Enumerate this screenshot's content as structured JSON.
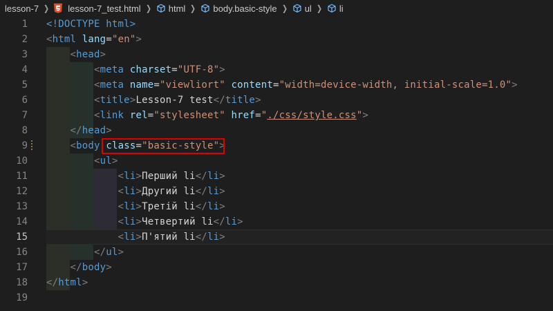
{
  "breadcrumb": {
    "folder": "lesson-7",
    "file": "lesson-7_test.html",
    "items": [
      "html",
      "body.basic-style",
      "ul",
      "li"
    ]
  },
  "editor": {
    "active_line": 15,
    "lines": [
      {
        "n": "1",
        "parts": [
          [
            "doctype",
            "<!DOCTYPE html>"
          ]
        ]
      },
      {
        "n": "2",
        "parts": [
          [
            "tag-br",
            "<"
          ],
          [
            "tag",
            "html"
          ],
          [
            "plain",
            " "
          ],
          [
            "attr",
            "lang"
          ],
          [
            "plain",
            "="
          ],
          [
            "str",
            "\"en\""
          ],
          [
            "tag-br",
            ">"
          ]
        ]
      },
      {
        "n": "3",
        "parts": [
          [
            "plain",
            "    "
          ],
          [
            "tag-br",
            "<"
          ],
          [
            "tag",
            "head"
          ],
          [
            "tag-br",
            ">"
          ]
        ]
      },
      {
        "n": "4",
        "parts": [
          [
            "plain",
            "        "
          ],
          [
            "tag-br",
            "<"
          ],
          [
            "tag",
            "meta"
          ],
          [
            "plain",
            " "
          ],
          [
            "attr",
            "charset"
          ],
          [
            "plain",
            "="
          ],
          [
            "str",
            "\"UTF-8\""
          ],
          [
            "tag-br",
            ">"
          ]
        ]
      },
      {
        "n": "5",
        "parts": [
          [
            "plain",
            "        "
          ],
          [
            "tag-br",
            "<"
          ],
          [
            "tag",
            "meta"
          ],
          [
            "plain",
            " "
          ],
          [
            "attr",
            "name"
          ],
          [
            "plain",
            "="
          ],
          [
            "str",
            "\"viewliort\""
          ],
          [
            "plain",
            " "
          ],
          [
            "attr",
            "content"
          ],
          [
            "plain",
            "="
          ],
          [
            "str",
            "\"width=device-width, initial-scale=1.0\""
          ],
          [
            "tag-br",
            ">"
          ]
        ]
      },
      {
        "n": "6",
        "parts": [
          [
            "plain",
            "        "
          ],
          [
            "tag-br",
            "<"
          ],
          [
            "tag",
            "title"
          ],
          [
            "tag-br",
            ">"
          ],
          [
            "plain",
            "Lesson-7 test"
          ],
          [
            "tag-br",
            "</"
          ],
          [
            "tag",
            "title"
          ],
          [
            "tag-br",
            ">"
          ]
        ]
      },
      {
        "n": "7",
        "parts": [
          [
            "plain",
            "        "
          ],
          [
            "tag-br",
            "<"
          ],
          [
            "tag",
            "link"
          ],
          [
            "plain",
            " "
          ],
          [
            "attr",
            "rel"
          ],
          [
            "plain",
            "="
          ],
          [
            "str",
            "\"stylesheet\""
          ],
          [
            "plain",
            " "
          ],
          [
            "attr",
            "href"
          ],
          [
            "plain",
            "="
          ],
          [
            "str",
            "\""
          ],
          [
            "link-str",
            "./css/style.css"
          ],
          [
            "str",
            "\""
          ],
          [
            "tag-br",
            ">"
          ]
        ]
      },
      {
        "n": "8",
        "parts": [
          [
            "plain",
            "    "
          ],
          [
            "tag-br",
            "</"
          ],
          [
            "tag",
            "head"
          ],
          [
            "tag-br",
            ">"
          ]
        ]
      },
      {
        "n": "9",
        "parts": [
          [
            "plain",
            "    "
          ],
          [
            "tag-br",
            "<"
          ],
          [
            "tag",
            "body"
          ],
          [
            "plain",
            " "
          ],
          [
            "attr",
            "class"
          ],
          [
            "plain",
            "="
          ],
          [
            "str",
            "\"basic-style\""
          ],
          [
            "tag-br",
            ">"
          ]
        ]
      },
      {
        "n": "10",
        "parts": [
          [
            "plain",
            "        "
          ],
          [
            "tag-br",
            "<"
          ],
          [
            "tag",
            "ul"
          ],
          [
            "tag-br",
            ">"
          ]
        ]
      },
      {
        "n": "11",
        "parts": [
          [
            "plain",
            "            "
          ],
          [
            "tag-br",
            "<"
          ],
          [
            "tag",
            "li"
          ],
          [
            "tag-br",
            ">"
          ],
          [
            "plain",
            "Перший li"
          ],
          [
            "tag-br",
            "</"
          ],
          [
            "tag",
            "li"
          ],
          [
            "tag-br",
            ">"
          ]
        ]
      },
      {
        "n": "12",
        "parts": [
          [
            "plain",
            "            "
          ],
          [
            "tag-br",
            "<"
          ],
          [
            "tag",
            "li"
          ],
          [
            "tag-br",
            ">"
          ],
          [
            "plain",
            "Другий li"
          ],
          [
            "tag-br",
            "</"
          ],
          [
            "tag",
            "li"
          ],
          [
            "tag-br",
            ">"
          ]
        ]
      },
      {
        "n": "13",
        "parts": [
          [
            "plain",
            "            "
          ],
          [
            "tag-br",
            "<"
          ],
          [
            "tag",
            "li"
          ],
          [
            "tag-br",
            ">"
          ],
          [
            "plain",
            "Третій li"
          ],
          [
            "tag-br",
            "</"
          ],
          [
            "tag",
            "li"
          ],
          [
            "tag-br",
            ">"
          ]
        ]
      },
      {
        "n": "14",
        "parts": [
          [
            "plain",
            "            "
          ],
          [
            "tag-br",
            "<"
          ],
          [
            "tag",
            "li"
          ],
          [
            "tag-br",
            ">"
          ],
          [
            "plain",
            "Четвертий li"
          ],
          [
            "tag-br",
            "</"
          ],
          [
            "tag",
            "li"
          ],
          [
            "tag-br",
            ">"
          ]
        ]
      },
      {
        "n": "15",
        "parts": [
          [
            "plain",
            "            "
          ],
          [
            "tag-br",
            "<"
          ],
          [
            "tag",
            "li"
          ],
          [
            "tag-br",
            ">"
          ],
          [
            "plain",
            "П'ятий li"
          ],
          [
            "tag-br",
            "</"
          ],
          [
            "tag",
            "li"
          ],
          [
            "tag-br",
            ">"
          ]
        ]
      },
      {
        "n": "16",
        "parts": [
          [
            "plain",
            "        "
          ],
          [
            "tag-br",
            "</"
          ],
          [
            "tag",
            "ul"
          ],
          [
            "tag-br",
            ">"
          ]
        ]
      },
      {
        "n": "17",
        "parts": [
          [
            "plain",
            "    "
          ],
          [
            "tag-br",
            "</"
          ],
          [
            "tag",
            "body"
          ],
          [
            "tag-br",
            ">"
          ]
        ]
      },
      {
        "n": "18",
        "parts": [
          [
            "tag-br",
            "</"
          ],
          [
            "tag",
            "html"
          ],
          [
            "tag-br",
            ">"
          ]
        ]
      },
      {
        "n": "19",
        "parts": []
      }
    ]
  },
  "colors": {
    "highlight_box": "#e00000",
    "tag": "#569cd6",
    "attribute": "#9cdcfe",
    "string": "#ce9178"
  },
  "icons": {
    "file_icon": "html5-icon",
    "breadcrumb_symbol_icon": "cube-icon"
  }
}
